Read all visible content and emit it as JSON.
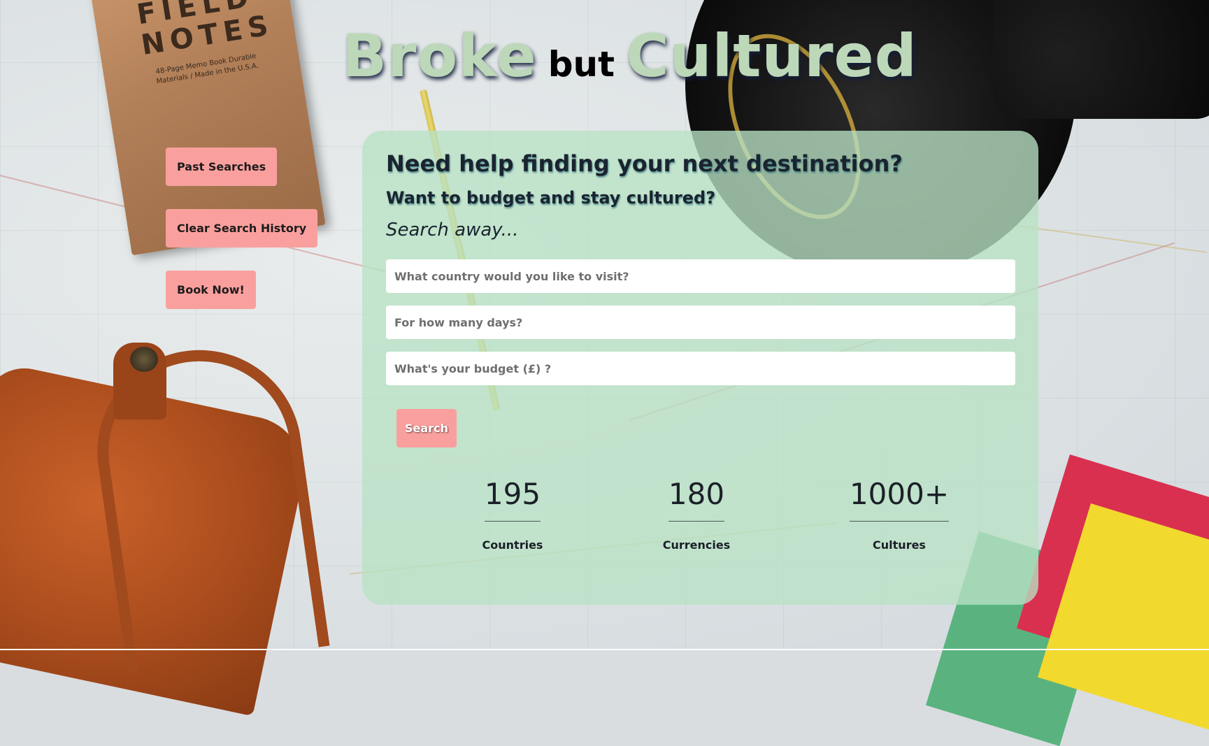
{
  "header": {
    "title_word1": "Broke",
    "title_word2": "but",
    "title_word3": "Cultured"
  },
  "sidebar": {
    "past_searches_label": "Past Searches",
    "clear_history_label": "Clear Search History",
    "book_now_label": "Book Now!"
  },
  "main": {
    "heading": "Need help finding your next destination?",
    "subheading": "Want to budget and stay cultured?",
    "tagline": "Search away...",
    "country_placeholder": "What country would you like to visit?",
    "days_placeholder": "For how many days?",
    "budget_placeholder": "What's your budget (£) ?",
    "search_label": "Search"
  },
  "stats": [
    {
      "value": "195",
      "label": "Countries"
    },
    {
      "value": "180",
      "label": "Currencies"
    },
    {
      "value": "1000+",
      "label": "Cultures"
    }
  ],
  "background": {
    "notebook_title": "FIELD NOTES",
    "notebook_subtitle": "48-Page Memo Book Durable Materials / Made in the U.S.A."
  },
  "colors": {
    "button_bg": "#f9a09e",
    "card_bg": "#b8e2c4",
    "title_color": "#bcd8b8",
    "text_dark": "#1a2430"
  }
}
